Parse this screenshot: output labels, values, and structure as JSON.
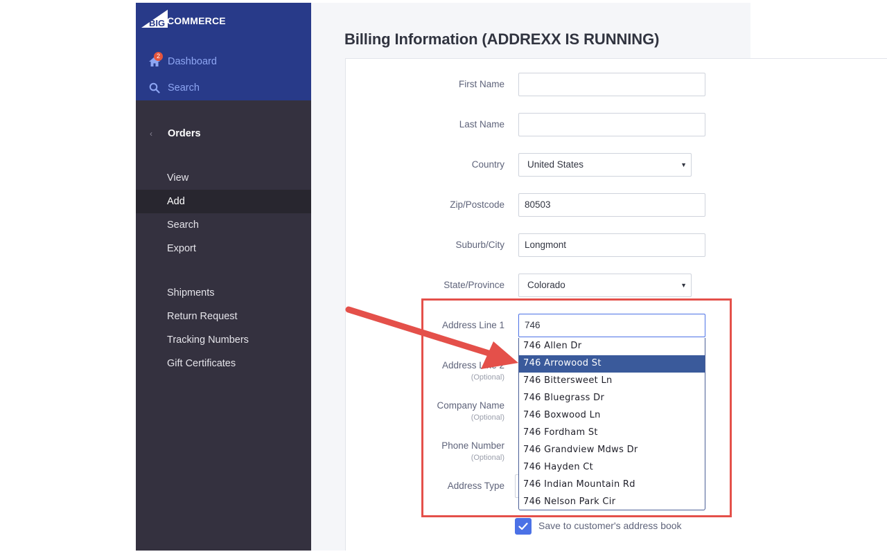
{
  "brand": {
    "logo_mark": "BIG",
    "logo_text": "COMMERCE"
  },
  "sidebar": {
    "top_items": [
      {
        "label": "Dashboard",
        "icon": "home-icon",
        "badge": "2"
      },
      {
        "label": "Search",
        "icon": "search-icon"
      }
    ],
    "section_title": "Orders",
    "items": [
      {
        "label": "View"
      },
      {
        "label": "Add",
        "active": true
      },
      {
        "label": "Search"
      },
      {
        "label": "Export"
      },
      {
        "label": "Shipments"
      },
      {
        "label": "Return Request"
      },
      {
        "label": "Tracking Numbers"
      },
      {
        "label": "Gift Certificates"
      }
    ]
  },
  "page": {
    "title": "Billing Information (ADDREXX IS RUNNING)"
  },
  "form": {
    "optional_text": "(Optional)",
    "fields": {
      "first_name": {
        "label": "First Name",
        "value": ""
      },
      "last_name": {
        "label": "Last Name",
        "value": ""
      },
      "country": {
        "label": "Country",
        "value": "United States"
      },
      "zip": {
        "label": "Zip/Postcode",
        "value": "80503"
      },
      "city": {
        "label": "Suburb/City",
        "value": "Longmont"
      },
      "state": {
        "label": "State/Province",
        "value": "Colorado"
      },
      "address1": {
        "label": "Address Line 1",
        "value": "746"
      },
      "address2": {
        "label": "Address Line 2",
        "value": ""
      },
      "company": {
        "label": "Company Name",
        "value": ""
      },
      "phone": {
        "label": "Phone Number",
        "value": ""
      },
      "address_type": {
        "label": "Address Type",
        "value": ""
      }
    },
    "save_checkbox": {
      "label": "Save to customer's address book",
      "checked": true
    }
  },
  "autocomplete": {
    "selected_index": 1,
    "suggestions": [
      "746 Allen Dr",
      "746 Arrowood St",
      "746 Bittersweet Ln",
      "746 Bluegrass Dr",
      "746 Boxwood Ln",
      "746 Fordham St",
      "746 Grandview Mdws Dr",
      "746 Hayden Ct",
      "746 Indian Mountain Rd",
      "746 Nelson Park Cir"
    ]
  },
  "colors": {
    "sidebar_header": "#283a89",
    "sidebar": "#34313f",
    "accent": "#4b71e6",
    "suggestion_highlight": "#3a5a9b",
    "annotation_red": "#e4504a",
    "badge": "#e5553d"
  }
}
